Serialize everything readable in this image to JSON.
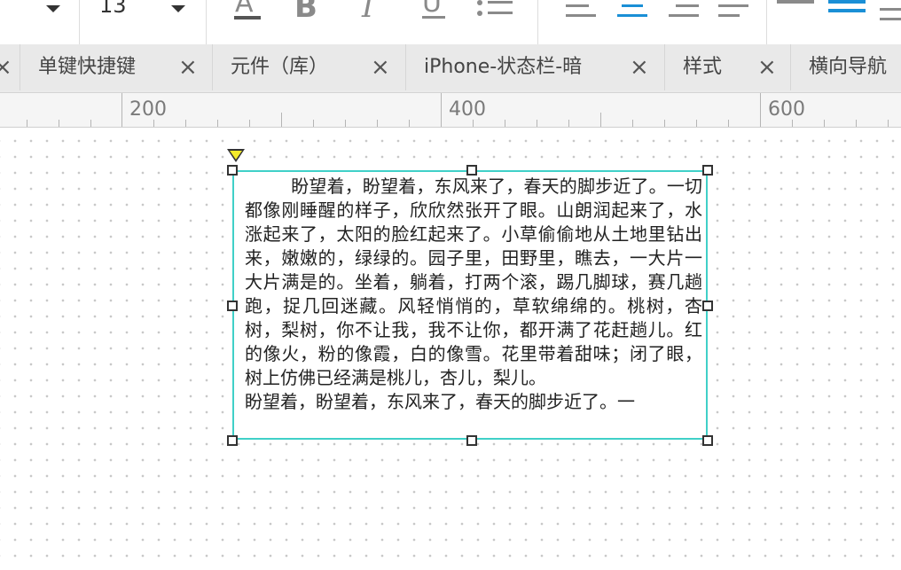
{
  "toolbar": {
    "font_size": "13",
    "icons": [
      "dropdown-caret",
      "font-color-icon",
      "bold-icon",
      "italic-icon",
      "underline-icon",
      "bullet-list-icon",
      "align-left-icon",
      "align-center-icon",
      "align-right-icon",
      "justify-icon",
      "line-spacing-icons"
    ],
    "bold_glyph": "B",
    "italic_glyph": "I",
    "underline_glyph": "U",
    "font_color_glyph": "A",
    "accent_color": "#1a8fd6"
  },
  "tabs": [
    {
      "label": "单键快捷键",
      "close": "×"
    },
    {
      "label": "元件（库）",
      "close": "×"
    },
    {
      "label": "iPhone-状态栏-暗",
      "close": "×"
    },
    {
      "label": "样式",
      "close": "×"
    },
    {
      "label": "横向导航",
      "close": ""
    }
  ],
  "ruler": {
    "labels": [
      "200",
      "400",
      "600"
    ]
  },
  "textbox": {
    "text": "        盼望着，盼望着，东风来了，春天的脚步近了。一切都像刚睡醒的样子，欣欣然张开了眼。山朗润起来了，水涨起来了，太阳的脸红起来了。小草偷偷地从土地里钻出来，嫩嫩的，绿绿的。园子里，田野里，瞧去，一大片一大片满是的。坐着，躺着，打两个滚，踢几脚球，赛几趟跑，捉几回迷藏。风轻悄悄的，草软绵绵的。桃树，杏树，梨树，你不让我，我不让你，都开满了花赶趟儿。红的像火，粉的像霞，白的像雪。花里带着甜味；闭了眼，树上仿佛已经满是桃儿，杏儿，梨儿。\n盼望着，盼望着，东风来了，春天的脚步近了。一",
    "border_color": "#40d0c8",
    "pin_color": "#f4ea2a"
  }
}
